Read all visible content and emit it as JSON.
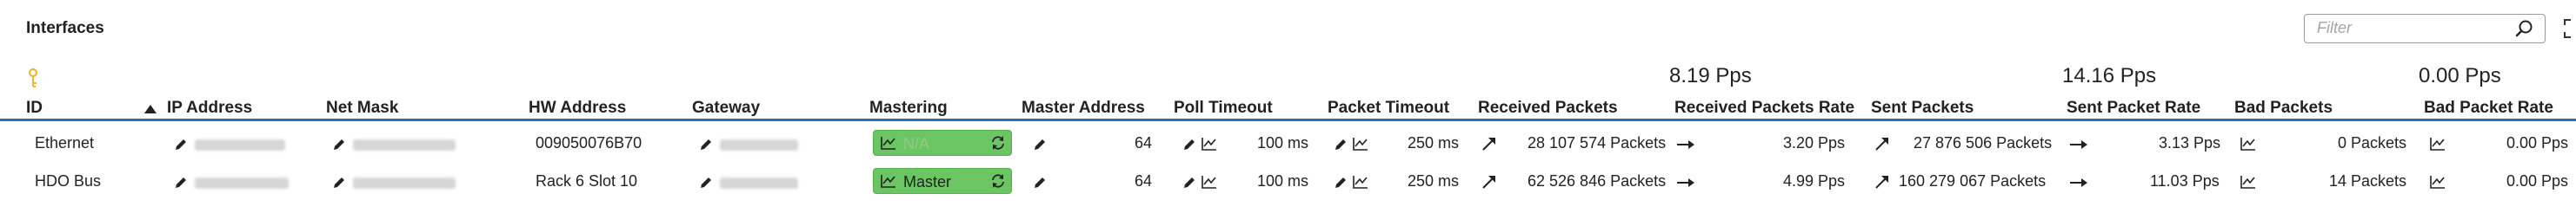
{
  "panel": {
    "title": "Interfaces"
  },
  "filter": {
    "placeholder": "Filter"
  },
  "summary": {
    "received_packets_rate": "8.19 Pps",
    "sent_packet_rate": "14.16 Pps",
    "bad_packet_rate": "0.00 Pps"
  },
  "columns": {
    "id": "ID",
    "ip_address": "IP Address",
    "net_mask": "Net Mask",
    "hw_address": "HW Address",
    "gateway": "Gateway",
    "mastering": "Mastering",
    "master_address": "Master Address",
    "poll_timeout": "Poll Timeout",
    "packet_timeout": "Packet Timeout",
    "received_packets": "Received Packets",
    "received_packets_rate": "Received Packets Rate",
    "sent_packets": "Sent Packets",
    "sent_packet_rate": "Sent Packet Rate",
    "bad_packets": "Bad Packets",
    "bad_packet_rate": "Bad Packet Rate"
  },
  "rows": [
    {
      "id": "Ethernet",
      "hw_address": "009050076B70",
      "mastering": "N/A",
      "master_address": "64",
      "poll_timeout": "100 ms",
      "packet_timeout": "250 ms",
      "received_packets": "28 107 574 Packets",
      "received_packets_rate": "3.20 Pps",
      "sent_packets": "27 876 506 Packets",
      "sent_packet_rate": "3.13 Pps",
      "bad_packets": "0 Packets",
      "bad_packet_rate": "0.00 Pps"
    },
    {
      "id": "HDO Bus",
      "hw_address": "Rack 6 Slot 10",
      "mastering": "Master",
      "master_address": "64",
      "poll_timeout": "100 ms",
      "packet_timeout": "250 ms",
      "received_packets": "62 526 846 Packets",
      "received_packets_rate": "4.99 Pps",
      "sent_packets": "160 279 067 Packets",
      "sent_packet_rate": "11.03 Pps",
      "bad_packets": "14 Packets",
      "bad_packet_rate": "0.00 Pps"
    }
  ],
  "colors": {
    "header_line": "#2e6fb0",
    "mastering_green": "#6cc563",
    "key_icon": "#e8b93a"
  }
}
